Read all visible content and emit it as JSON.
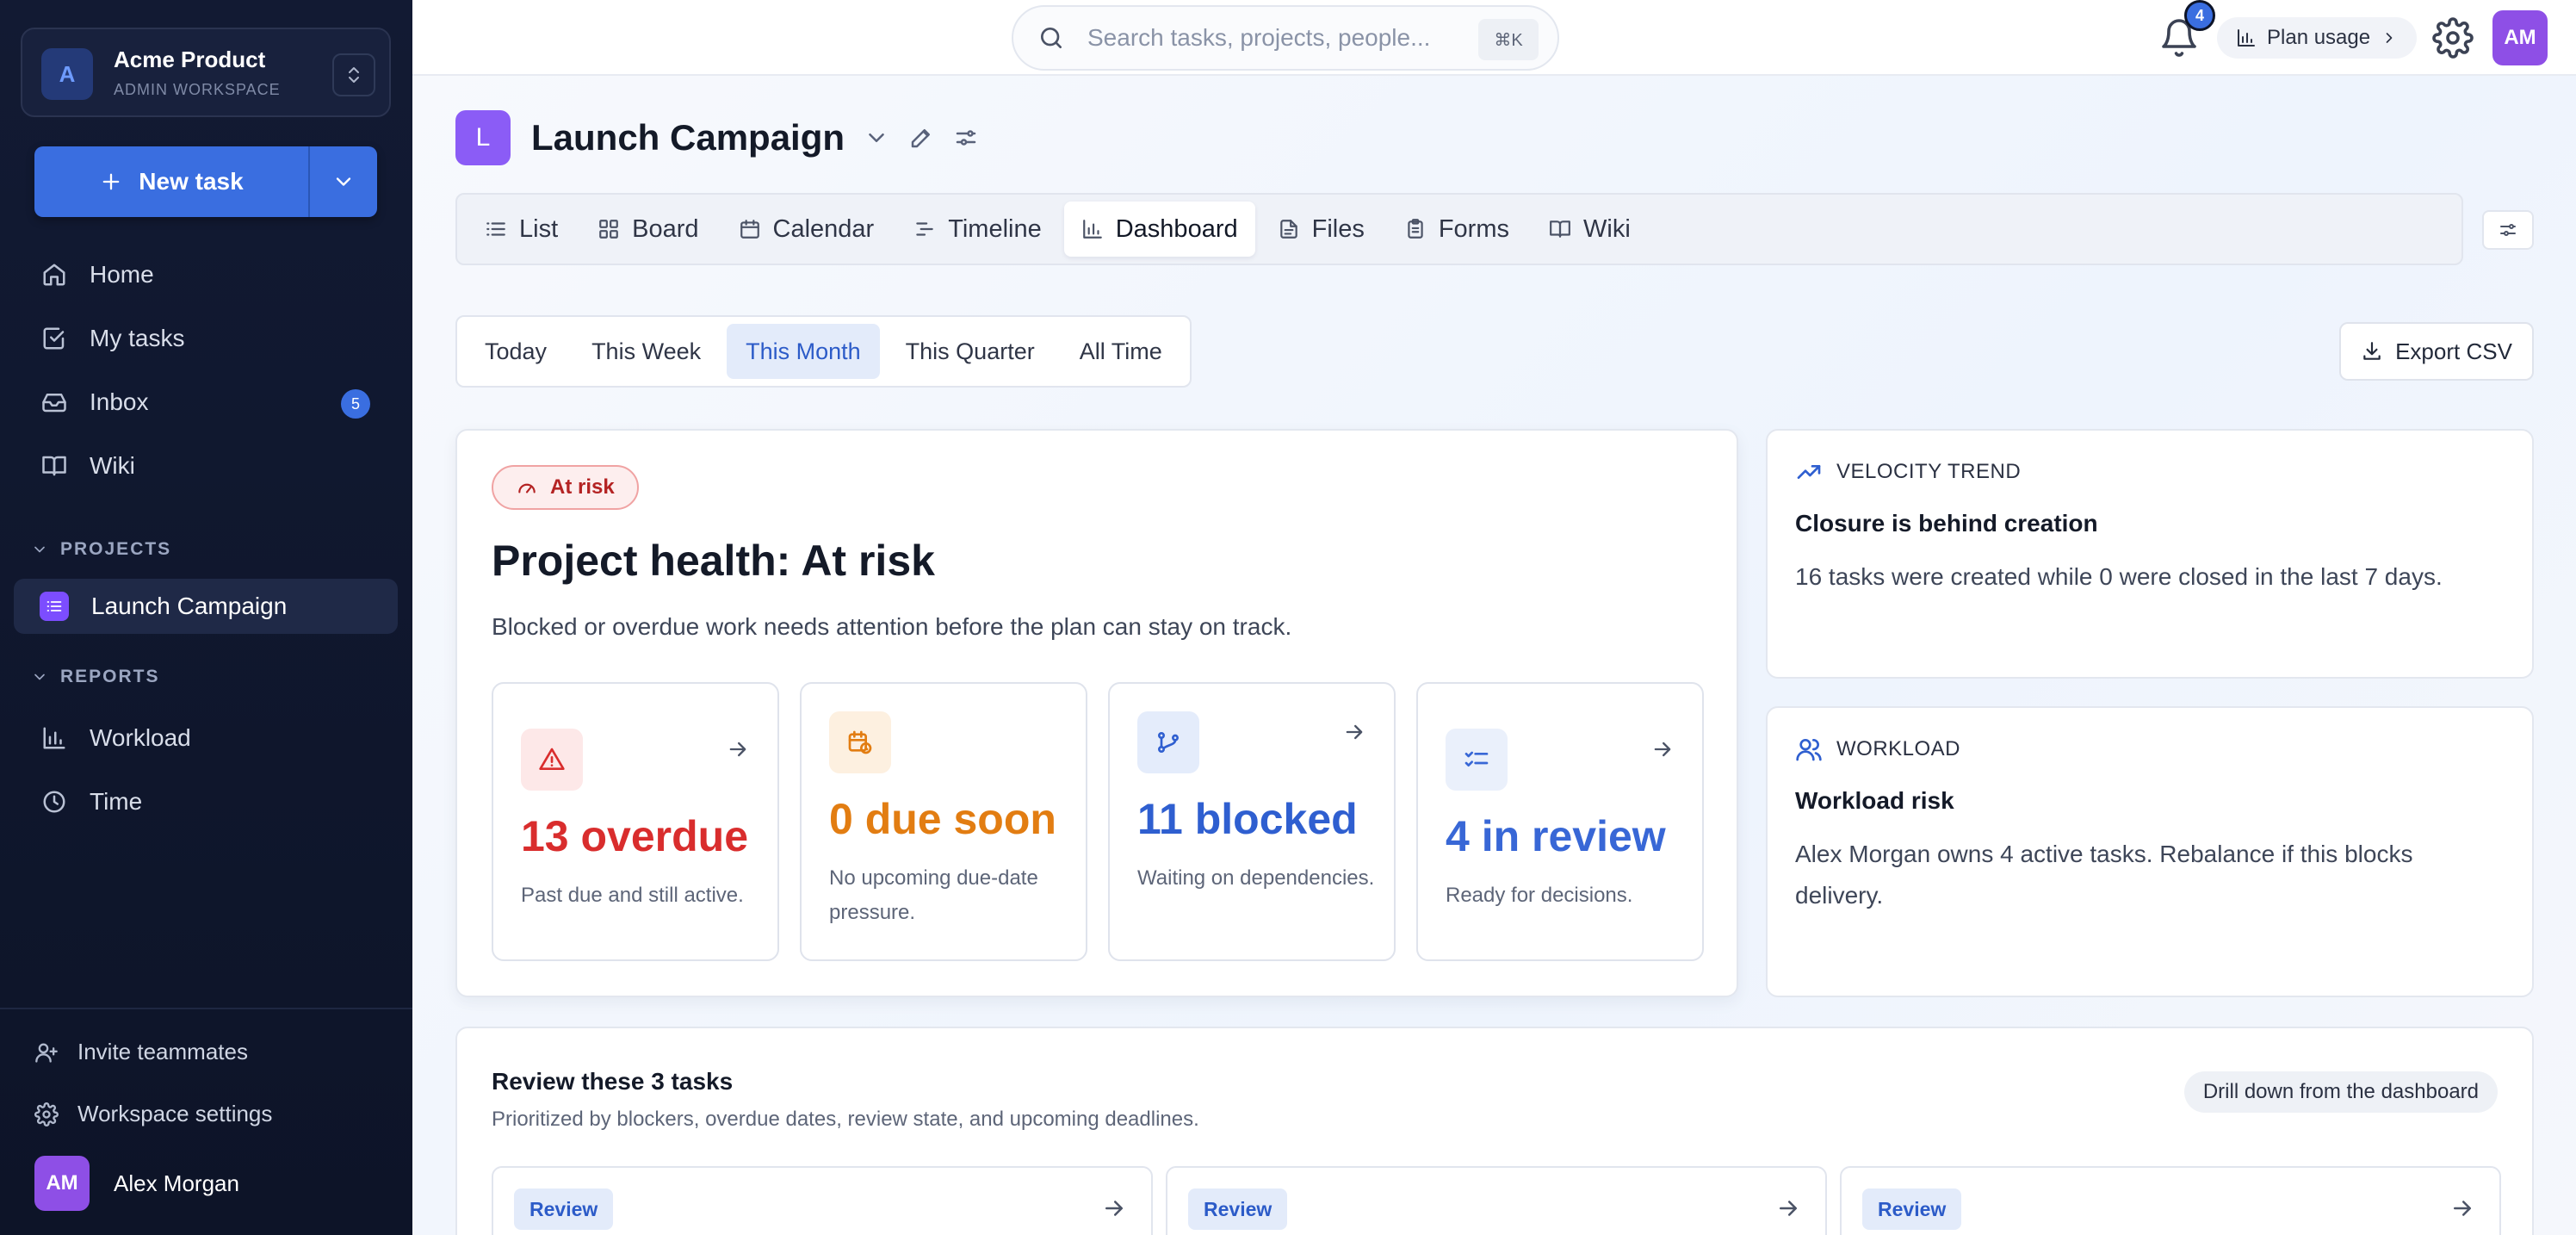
{
  "workspace": {
    "avatar": "A",
    "name": "Acme Product",
    "subtitle": "ADMIN WORKSPACE"
  },
  "sidebar": {
    "new_task_label": "New task",
    "nav": [
      {
        "label": "Home",
        "icon": "home-icon"
      },
      {
        "label": "My tasks",
        "icon": "check-square-icon"
      },
      {
        "label": "Inbox",
        "icon": "inbox-icon",
        "badge": "5"
      },
      {
        "label": "Wiki",
        "icon": "book-icon"
      }
    ],
    "projects_heading": "PROJECTS",
    "projects": [
      {
        "label": "Launch Campaign"
      }
    ],
    "reports_heading": "REPORTS",
    "reports": [
      {
        "label": "Workload",
        "icon": "bar-chart-icon"
      },
      {
        "label": "Time",
        "icon": "clock-icon"
      }
    ],
    "invite_label": "Invite teammates",
    "settings_label": "Workspace settings",
    "user": {
      "initials": "AM",
      "name": "Alex Morgan"
    }
  },
  "topbar": {
    "search_placeholder": "Search tasks, projects, people...",
    "search_shortcut": "⌘K",
    "notifications_count": "4",
    "plan_usage_label": "Plan usage",
    "user_initials": "AM"
  },
  "project": {
    "badge": "L",
    "title": "Launch Campaign",
    "tabs": [
      {
        "label": "List",
        "icon": "list-icon"
      },
      {
        "label": "Board",
        "icon": "board-icon"
      },
      {
        "label": "Calendar",
        "icon": "calendar-icon"
      },
      {
        "label": "Timeline",
        "icon": "timeline-icon"
      },
      {
        "label": "Dashboard",
        "icon": "bar-chart-icon",
        "active": true
      },
      {
        "label": "Files",
        "icon": "file-icon"
      },
      {
        "label": "Forms",
        "icon": "clipboard-icon"
      },
      {
        "label": "Wiki",
        "icon": "book-icon"
      }
    ]
  },
  "range": {
    "options": [
      "Today",
      "This Week",
      "This Month",
      "This Quarter",
      "All Time"
    ],
    "selected": "This Month",
    "export_label": "Export CSV"
  },
  "health": {
    "status_pill": "At risk",
    "title": "Project health: At risk",
    "description": "Blocked or overdue work needs attention before the plan can stay on track.",
    "metrics": [
      {
        "value": "13 overdue",
        "description": "Past due and still active.",
        "color": "#d92d2d",
        "icon_bg": "#fde8e8"
      },
      {
        "value": "0 due soon",
        "description": "No upcoming due-date pressure.",
        "color": "#e27d12",
        "icon_bg": "#fdf0e0"
      },
      {
        "value": "11 blocked",
        "description": "Waiting on dependencies.",
        "color": "#2f5fd0",
        "icon_bg": "#e4ecfb"
      },
      {
        "value": "4 in review",
        "description": "Ready for decisions.",
        "color": "#3867d6",
        "icon_bg": "#eaf0fb"
      }
    ]
  },
  "velocity": {
    "heading": "VELOCITY TREND",
    "title": "Closure is behind creation",
    "body": "16 tasks were created while 0 were closed in the last 7 days."
  },
  "workload": {
    "heading": "WORKLOAD",
    "title": "Workload risk",
    "body": "Alex Morgan owns 4 active tasks. Rebalance if this blocks delivery."
  },
  "review": {
    "title": "Review these 3 tasks",
    "subtitle": "Prioritized by blockers, overdue dates, review state, and upcoming deadlines.",
    "chip": "Drill down from the dashboard",
    "cards": [
      {
        "tag": "Review"
      },
      {
        "tag": "Review"
      },
      {
        "tag": "Review"
      }
    ]
  }
}
